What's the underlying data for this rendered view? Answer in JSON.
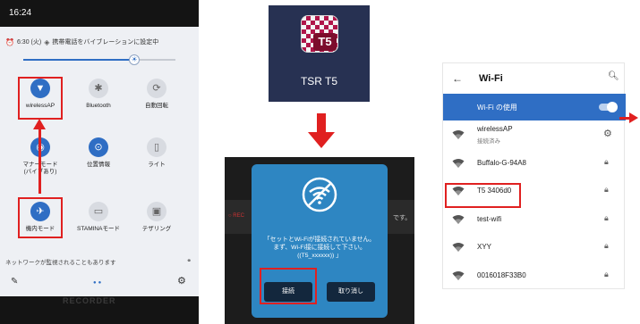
{
  "panel1": {
    "status_time": "16:24",
    "alarm_text": "6:30 (火)",
    "vibration_text": "携帯電話をバイブレーションに設定中",
    "brightness_fraction": 0.73,
    "tiles": [
      {
        "label": "wirelessAP",
        "icon": "wifi-icon",
        "glyph": "▼",
        "active": true
      },
      {
        "label": "Bluetooth",
        "icon": "bluetooth-icon",
        "glyph": "✱",
        "active": false
      },
      {
        "label": "自動回転",
        "icon": "rotate-icon",
        "glyph": "⟳",
        "active": false
      },
      {
        "label": "マナーモード\n(バイブあり)",
        "icon": "vibrate-icon",
        "glyph": "◉",
        "active": true
      },
      {
        "label": "位置情報",
        "icon": "location-icon",
        "glyph": "⊙",
        "active": true
      },
      {
        "label": "ライト",
        "icon": "flashlight-icon",
        "glyph": "▯",
        "active": false
      },
      {
        "label": "機内モード",
        "icon": "airplane-icon",
        "glyph": "✈",
        "active": true
      },
      {
        "label": "STAMINAモード",
        "icon": "battery-icon",
        "glyph": "▭",
        "active": false
      },
      {
        "label": "テザリング",
        "icon": "tethering-icon",
        "glyph": "▣",
        "active": false
      }
    ],
    "monitor_text": "ネットワークが監視されることもあります",
    "background_text": "RECORDER"
  },
  "panel2": {
    "app_name": "TSR T5",
    "app_badge": "T5",
    "dialog_message": "「セットとWi-Fiが接続されていません。\nまず、Wi-Fi接に接続して下さい。\n((T5_xxxxxx)) 」",
    "connect_label": "接続",
    "cancel_label": "取り消し",
    "side_left": "○ REC",
    "side_right": "です。"
  },
  "panel3": {
    "title": "Wi-Fi",
    "use_label": "Wi-Fi の使用",
    "networks": [
      {
        "name": "wirelessAP",
        "sub": "接続済み",
        "action": "gear"
      },
      {
        "name": "Buffalo-G-94A8",
        "sub": "",
        "action": "lock"
      },
      {
        "name": "T5 3406d0",
        "sub": "",
        "action": "lock"
      },
      {
        "name": "test-wifi",
        "sub": "",
        "action": "lock"
      },
      {
        "name": "XYY",
        "sub": "",
        "action": "lock"
      },
      {
        "name": "0016018F33B0",
        "sub": "",
        "action": "lock"
      }
    ]
  },
  "colors": {
    "accent_blue": "#2f6ec4",
    "highlight_red": "#e02020",
    "dialog_blue": "#2e86c2",
    "app_tile_navy": "#273152"
  }
}
